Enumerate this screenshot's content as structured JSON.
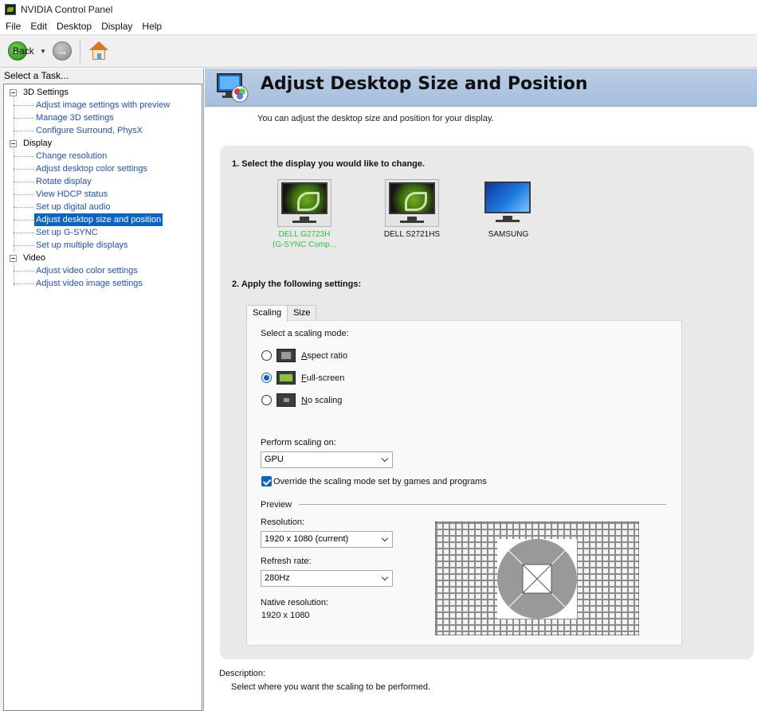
{
  "window": {
    "title": "NVIDIA Control Panel"
  },
  "menu": [
    "File",
    "Edit",
    "Desktop",
    "Display",
    "Help"
  ],
  "toolbar": {
    "back_label": "Back"
  },
  "sidebar": {
    "header": "Select a Task...",
    "categories": [
      {
        "label": "3D Settings",
        "items": [
          "Adjust image settings with preview",
          "Manage 3D settings",
          "Configure Surround, PhysX"
        ]
      },
      {
        "label": "Display",
        "items": [
          "Change resolution",
          "Adjust desktop color settings",
          "Rotate display",
          "View HDCP status",
          "Set up digital audio",
          "Adjust desktop size and position",
          "Set up G-SYNC",
          "Set up multiple displays"
        ]
      },
      {
        "label": "Video",
        "items": [
          "Adjust video color settings",
          "Adjust video image settings"
        ]
      }
    ],
    "selected": "Adjust desktop size and position"
  },
  "page": {
    "title": "Adjust Desktop Size and Position",
    "intro": "You can adjust the desktop size and position for your display.",
    "step1": "1. Select the display you would like to change.",
    "step2": "2. Apply the following settings:",
    "displays": [
      {
        "line1": "DELL G2723H",
        "line2": "(G-SYNC Comp...",
        "selected": true,
        "icon": "nvidia-monitor-icon"
      },
      {
        "line1": "DELL S2721HS",
        "line2": "",
        "selected": false,
        "icon": "nvidia-monitor-icon"
      },
      {
        "line1": "SAMSUNG",
        "line2": "",
        "selected": false,
        "icon": "windows-monitor-icon"
      }
    ],
    "tabs": [
      "Scaling",
      "Size"
    ],
    "active_tab": "Scaling",
    "scaling_mode_label": "Select a scaling mode:",
    "modes": [
      {
        "underline": "A",
        "rest": "spect ratio",
        "checked": false
      },
      {
        "underline": "F",
        "rest": "ull-screen",
        "checked": true
      },
      {
        "underline": "N",
        "rest": "o scaling",
        "checked": false
      }
    ],
    "perform_label": "Perform scaling on:",
    "perform_value": "GPU",
    "override_label": "Override the scaling mode set by games and programs",
    "override_checked": true,
    "preview_label": "Preview",
    "resolution_label": "Resolution:",
    "resolution_value": "1920 x 1080 (current)",
    "refresh_label": "Refresh rate:",
    "refresh_value": "280Hz",
    "native_label": "Native resolution:",
    "native_value": "1920 x 1080",
    "description_label": "Description:",
    "description_value": "Select where you want the scaling to be performed."
  },
  "colors": {
    "accent": "#0a64c8",
    "link": "#1f4fc9",
    "nvidia_green": "#76b900",
    "active_display": "#2fbf3b"
  }
}
